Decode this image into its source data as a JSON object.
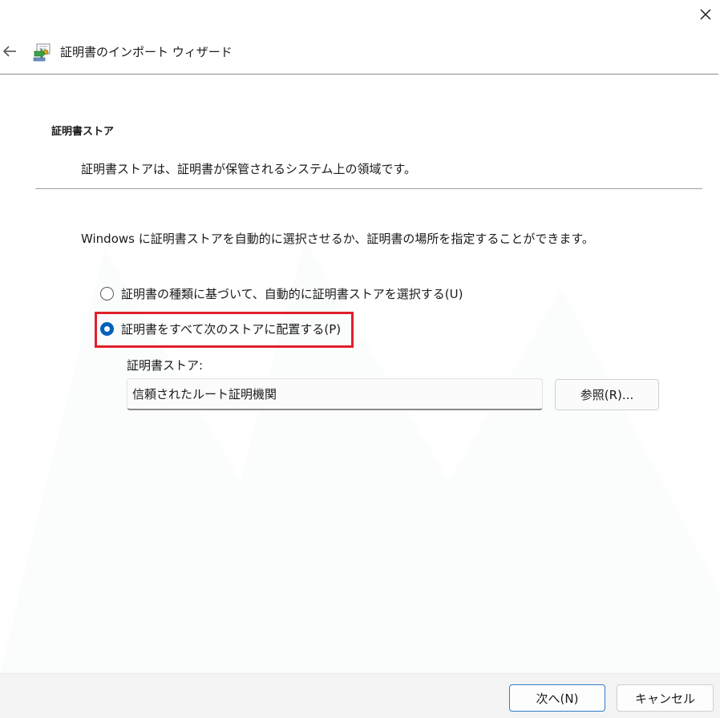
{
  "window": {
    "title": "証明書のインポート ウィザード",
    "accent_color": "#005fb8",
    "highlight_color": "#e0202a"
  },
  "icons": {
    "close": "close-icon",
    "back": "back-arrow-icon",
    "wizard": "certificate-import-icon"
  },
  "section": {
    "title": "証明書ストア",
    "description": "証明書ストアは、証明書が保管されるシステム上の領域です。"
  },
  "intro": "Windows に証明書ストアを自動的に選択させるか、証明書の場所を指定することができます。",
  "options": {
    "auto": {
      "label": "証明書の種類に基づいて、自動的に証明書ストアを選択する(U)",
      "checked": false
    },
    "place": {
      "label": "証明書をすべて次のストアに配置する(P)",
      "checked": true
    }
  },
  "store": {
    "label": "証明書ストア:",
    "value": "信頼されたルート証明機関",
    "browse_label": "参照(R)..."
  },
  "footer": {
    "next_label": "次へ(N)",
    "cancel_label": "キャンセル"
  }
}
